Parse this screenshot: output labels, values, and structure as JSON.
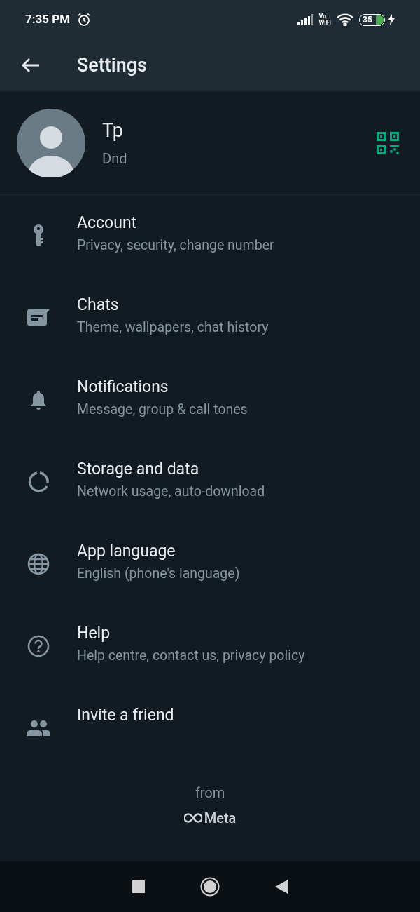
{
  "status_bar": {
    "time": "7:35 PM",
    "vowifi_top": "Vo",
    "vowifi_bottom": "WiFi",
    "battery": "35"
  },
  "header": {
    "title": "Settings"
  },
  "profile": {
    "name": "Tp",
    "about": "Dnd"
  },
  "items": [
    {
      "kind": "key",
      "title": "Account",
      "subtitle": "Privacy, security, change number"
    },
    {
      "kind": "chat",
      "title": "Chats",
      "subtitle": "Theme, wallpapers, chat history"
    },
    {
      "kind": "bell",
      "title": "Notifications",
      "subtitle": "Message, group & call tones"
    },
    {
      "kind": "storage",
      "title": "Storage and data",
      "subtitle": "Network usage, auto-download"
    },
    {
      "kind": "globe",
      "title": "App language",
      "subtitle": "English (phone's language)"
    },
    {
      "kind": "help",
      "title": "Help",
      "subtitle": "Help centre, contact us, privacy policy"
    },
    {
      "kind": "people",
      "title": "Invite a friend"
    }
  ],
  "footer": {
    "from": "from",
    "brand": "Meta"
  }
}
